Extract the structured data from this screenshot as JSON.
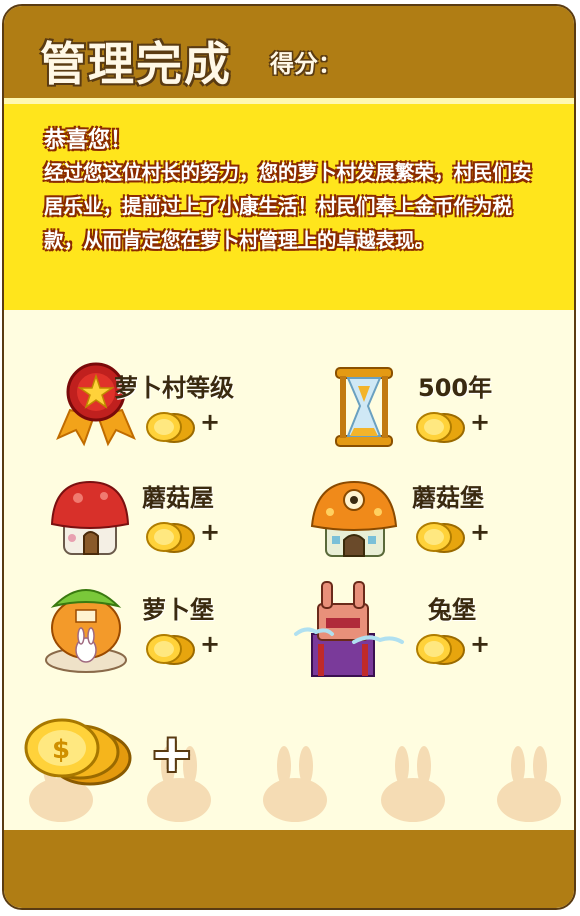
{
  "header": {
    "title": "管理完成",
    "score_label": "得分："
  },
  "message": {
    "title": "恭喜您！",
    "body": "经过您这位村长的努力，您的萝卜村发展繁荣，村民们安居乐业，提前过上了小康生活！村民们奉上金币作为税款，从而肯定您在萝卜村管理上的卓越表现。"
  },
  "rewards": [
    {
      "label": "萝卜村等级",
      "icon": "medal-icon",
      "plus": "+"
    },
    {
      "label": "500年",
      "icon": "hourglass-icon",
      "plus": "+"
    },
    {
      "label": "蘑菇屋",
      "icon": "mushroom-house-icon",
      "plus": "+"
    },
    {
      "label": "蘑菇堡",
      "icon": "mushroom-castle-icon",
      "plus": "+"
    },
    {
      "label": "萝卜堡",
      "icon": "carrot-castle-icon",
      "plus": "+"
    },
    {
      "label": "兔堡",
      "icon": "rabbit-castle-icon",
      "plus": "+"
    }
  ],
  "total": {
    "plus": "+"
  },
  "colors": {
    "header": "#b07d14",
    "message_bg": "#ffe51c",
    "panel_bg": "#fffde0",
    "text_outline": "#8a2a00"
  }
}
